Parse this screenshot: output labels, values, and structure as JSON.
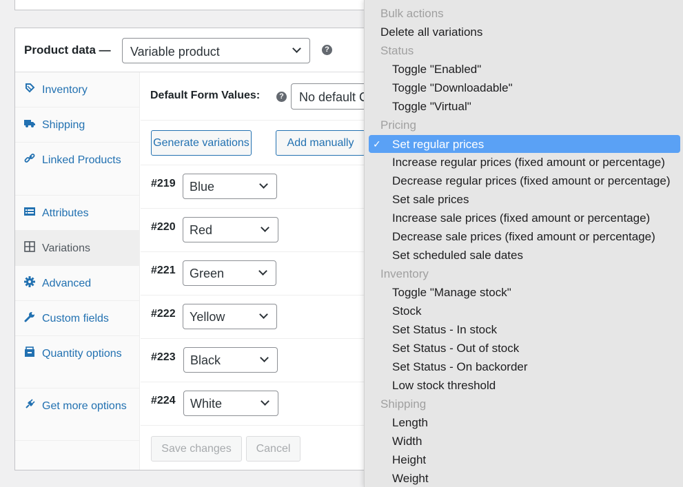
{
  "product_data": {
    "title": "Product data —",
    "type_value": "Variable product",
    "help": "?"
  },
  "tabs": [
    {
      "label": "Inventory",
      "icon": "inventory-icon"
    },
    {
      "label": "Shipping",
      "icon": "truck-icon"
    },
    {
      "label": "Linked Products",
      "icon": "link-icon"
    },
    {
      "label": "Attributes",
      "icon": "list-icon"
    },
    {
      "label": "Variations",
      "icon": "grid-icon",
      "active": true
    },
    {
      "label": "Advanced",
      "icon": "gear-icon"
    },
    {
      "label": "Custom fields",
      "icon": "wrench-icon"
    },
    {
      "label": "Quantity options",
      "icon": "box-icon"
    },
    {
      "label": "Get more options",
      "icon": "plugin-icon"
    }
  ],
  "variations": {
    "default_form_label": "Default Form Values:",
    "default_form_value": "No default C",
    "generate_button": "Generate variations",
    "add_manually_button": "Add manually",
    "rows": [
      {
        "id": "#219",
        "value": "Blue"
      },
      {
        "id": "#220",
        "value": "Red"
      },
      {
        "id": "#221",
        "value": "Green"
      },
      {
        "id": "#222",
        "value": "Yellow"
      },
      {
        "id": "#223",
        "value": "Black"
      },
      {
        "id": "#224",
        "value": "White"
      }
    ],
    "save_button": "Save changes",
    "cancel_button": "Cancel"
  },
  "bulk_menu": {
    "items": [
      {
        "kind": "group",
        "label": "Bulk actions"
      },
      {
        "kind": "top",
        "label": "Delete all variations"
      },
      {
        "kind": "group",
        "label": "Status"
      },
      {
        "kind": "opt",
        "label": "Toggle \"Enabled\""
      },
      {
        "kind": "opt",
        "label": "Toggle \"Downloadable\""
      },
      {
        "kind": "opt",
        "label": "Toggle \"Virtual\""
      },
      {
        "kind": "group",
        "label": "Pricing"
      },
      {
        "kind": "selected",
        "label": "Set regular prices"
      },
      {
        "kind": "opt",
        "label": "Increase regular prices (fixed amount or percentage)"
      },
      {
        "kind": "opt",
        "label": "Decrease regular prices (fixed amount or percentage)"
      },
      {
        "kind": "opt",
        "label": "Set sale prices"
      },
      {
        "kind": "opt",
        "label": "Increase sale prices (fixed amount or percentage)"
      },
      {
        "kind": "opt",
        "label": "Decrease sale prices (fixed amount or percentage)"
      },
      {
        "kind": "opt",
        "label": "Set scheduled sale dates"
      },
      {
        "kind": "group",
        "label": "Inventory"
      },
      {
        "kind": "opt",
        "label": "Toggle \"Manage stock\""
      },
      {
        "kind": "opt",
        "label": "Stock"
      },
      {
        "kind": "opt",
        "label": "Set Status - In stock"
      },
      {
        "kind": "opt",
        "label": "Set Status - Out of stock"
      },
      {
        "kind": "opt",
        "label": "Set Status - On backorder"
      },
      {
        "kind": "opt",
        "label": "Low stock threshold"
      },
      {
        "kind": "group",
        "label": "Shipping"
      },
      {
        "kind": "opt",
        "label": "Length"
      },
      {
        "kind": "opt",
        "label": "Width"
      },
      {
        "kind": "opt",
        "label": "Height"
      },
      {
        "kind": "opt",
        "label": "Weight"
      }
    ],
    "check_glyph": "✓",
    "selected_color": "#5aa1f5"
  }
}
